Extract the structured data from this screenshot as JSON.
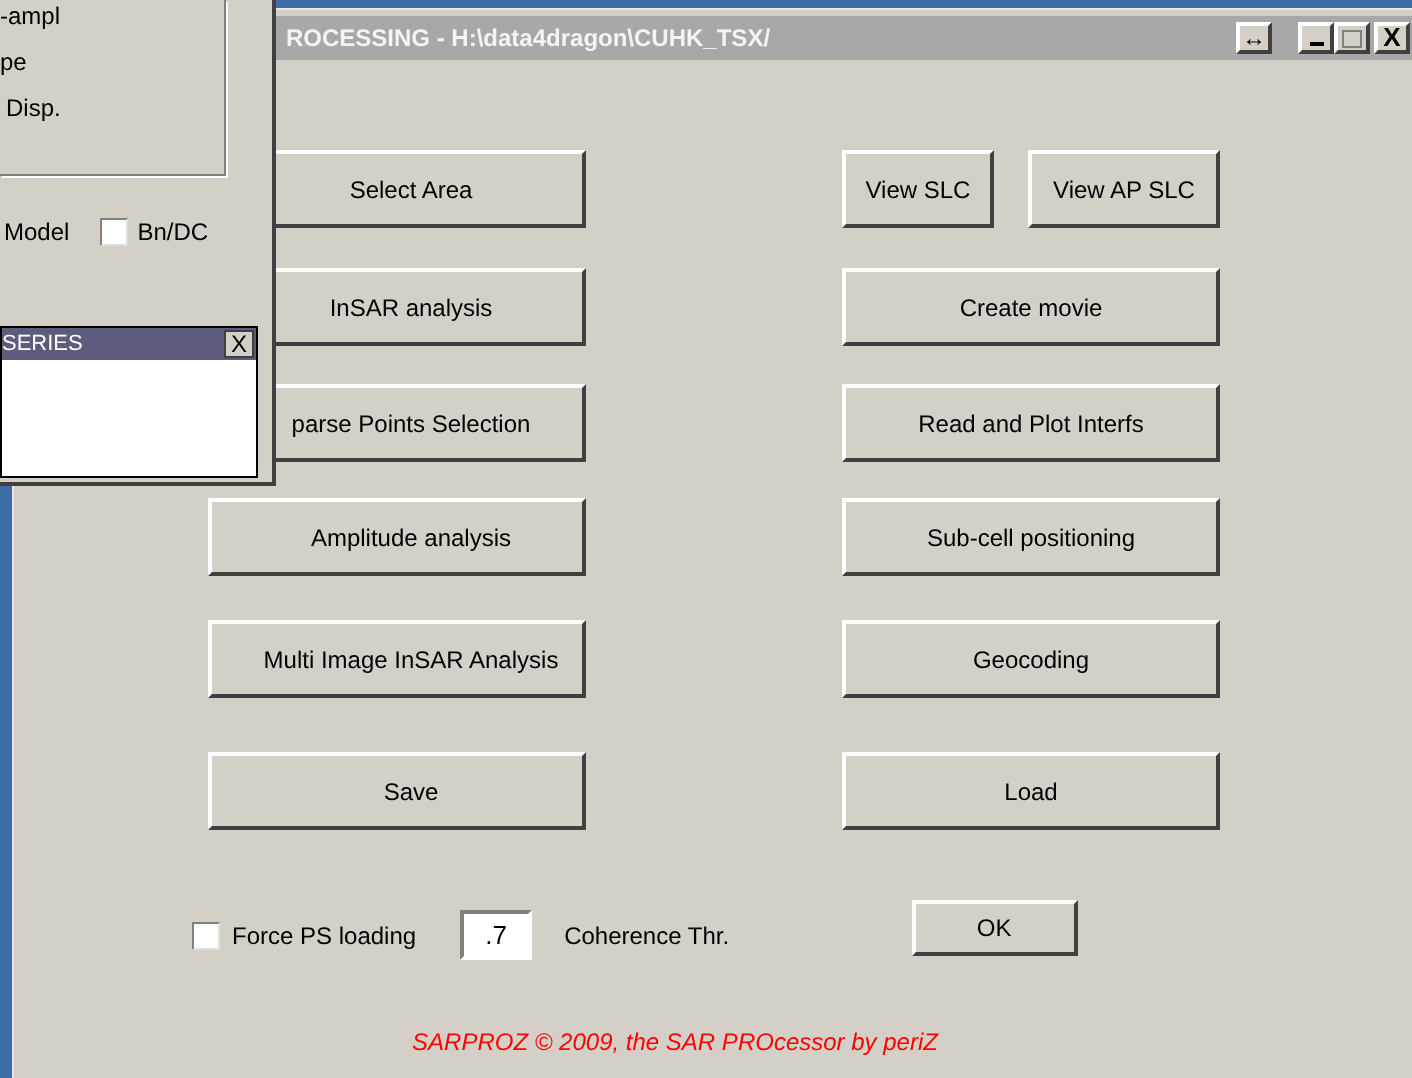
{
  "main_window": {
    "title": "ROCESSING - H:\\data4dragon\\CUHK_TSX/",
    "resize_glyph": "↔",
    "close_glyph": "X"
  },
  "rows": [
    {
      "left": "Select Area",
      "right": [
        "View SLC",
        "View AP SLC"
      ]
    },
    {
      "left": "InSAR analysis",
      "right": [
        "Create movie"
      ]
    },
    {
      "left": "parse Points Selection",
      "right": [
        "Read and Plot Interfs"
      ]
    },
    {
      "left": "Amplitude analysis",
      "right": [
        "Sub-cell positioning"
      ]
    },
    {
      "left": "Multi Image InSAR Analysis",
      "right": [
        "Geocoding"
      ]
    },
    {
      "left": "Save",
      "right": [
        "Load"
      ]
    }
  ],
  "options": {
    "force_ps": {
      "label": "Force PS loading",
      "checked": false
    },
    "coherence": {
      "value": ".7",
      "label": "Coherence Thr."
    },
    "ok": "OK"
  },
  "footer": "SARPROZ © 2009, the SAR PROcessor by periZ",
  "side_window": {
    "lines": [
      "-ampl",
      "pe",
      "Disp."
    ],
    "model_label": "Model",
    "bn_dc": {
      "label": "Bn/DC",
      "checked": false
    },
    "series": {
      "title": "SERIES",
      "close": "X"
    }
  }
}
